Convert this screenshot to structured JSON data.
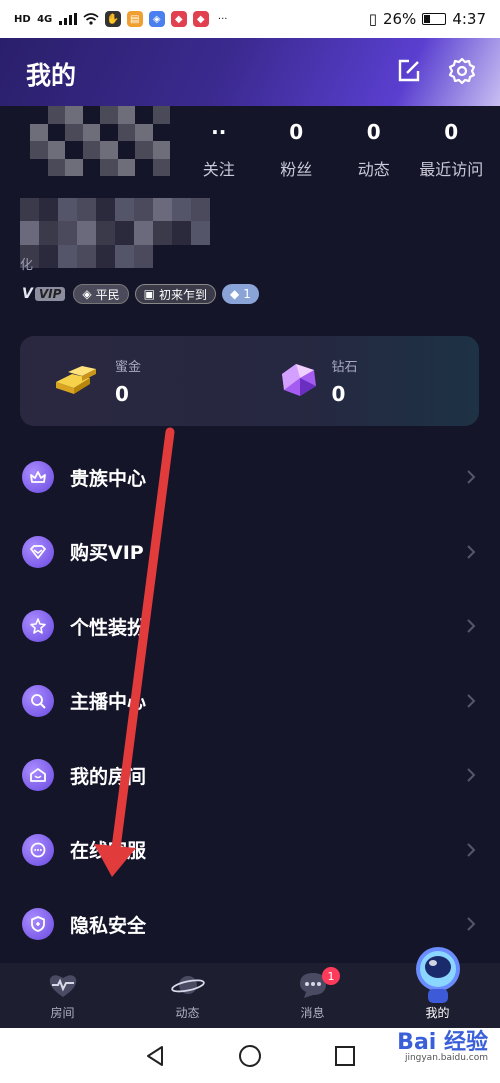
{
  "statusbar": {
    "left_labels": [
      "HD",
      "4G"
    ],
    "battery_percent": "26%",
    "battery_level": 0.26,
    "time": "4:37"
  },
  "header": {
    "title": "我的",
    "edit_icon": "edit-icon",
    "settings_icon": "gear-icon"
  },
  "profile": {
    "stats": [
      {
        "value": "··",
        "label": "关注"
      },
      {
        "value": "0",
        "label": "粉丝"
      },
      {
        "value": "0",
        "label": "动态"
      },
      {
        "value": "0",
        "label": "最近访问"
      }
    ],
    "name_fragment": "化",
    "badges": {
      "vip": "VIP",
      "grade": "平民",
      "title": "初来乍到",
      "level": "1"
    }
  },
  "wallet": {
    "items": [
      {
        "label": "蜜金",
        "value": "0",
        "icon": "gold-bar-icon"
      },
      {
        "label": "钻石",
        "value": "0",
        "icon": "diamond-icon"
      }
    ]
  },
  "menu": {
    "items": [
      {
        "label": "贵族中心",
        "icon": "crown-icon"
      },
      {
        "label": "购买VIP",
        "icon": "vip-diamond-icon"
      },
      {
        "label": "个性装扮",
        "icon": "star-icon"
      },
      {
        "label": "主播中心",
        "icon": "anchor-search-icon"
      },
      {
        "label": "我的房间",
        "icon": "house-icon"
      },
      {
        "label": "在线客服",
        "icon": "chat-icon"
      },
      {
        "label": "隐私安全",
        "icon": "shield-icon"
      }
    ]
  },
  "bottomnav": {
    "items": [
      {
        "label": "房间",
        "icon": "heartbeat-icon"
      },
      {
        "label": "动态",
        "icon": "planet-icon"
      },
      {
        "label": "消息",
        "icon": "message-icon",
        "badge": "1"
      },
      {
        "label": "我的",
        "icon": "astronaut-icon"
      }
    ]
  },
  "watermark": {
    "brand": "Bai 经验",
    "url": "jingyan.baidu.com"
  },
  "colors": {
    "background": "#15152a",
    "accent": "#7b5cf0",
    "arrow": "#e23b3b",
    "badge": "#ff3b5c"
  }
}
